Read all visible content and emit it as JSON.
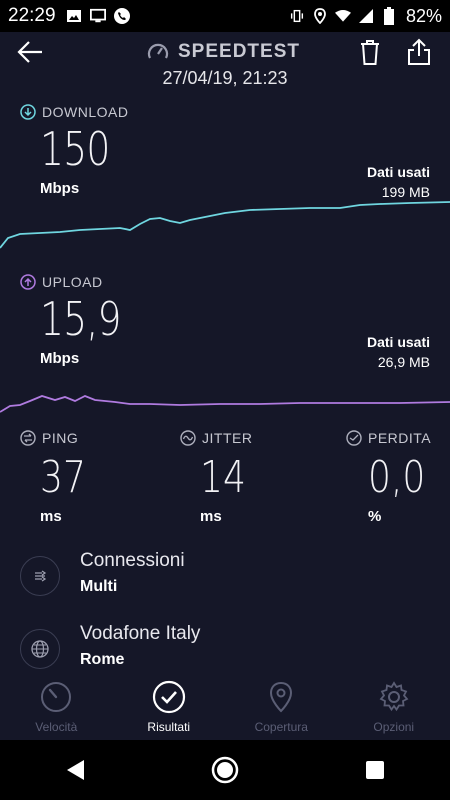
{
  "status_bar": {
    "time": "22:29",
    "battery": "82%"
  },
  "header": {
    "title": "SPEEDTEST",
    "datetime": "27/04/19, 21:23"
  },
  "download": {
    "label": "DOWNLOAD",
    "value": "150",
    "unit": "Mbps",
    "data_used_label": "Dati usati",
    "data_used_value": "199 MB",
    "color": "#6fd6e0"
  },
  "upload": {
    "label": "UPLOAD",
    "value": "15,9",
    "unit": "Mbps",
    "data_used_label": "Dati usati",
    "data_used_value": "26,9 MB",
    "color": "#b07be0"
  },
  "metrics": [
    {
      "label": "PING",
      "value": "37",
      "unit": "ms",
      "icon": "ping-icon"
    },
    {
      "label": "JITTER",
      "value": "14",
      "unit": "ms",
      "icon": "jitter-icon"
    },
    {
      "label": "PERDITA",
      "value": "0,0",
      "unit": "%",
      "icon": "loss-icon"
    }
  ],
  "info": [
    {
      "title": "Connessioni",
      "subtitle": "Multi",
      "icon": "connections-icon"
    },
    {
      "title": "Vodafone Italy",
      "subtitle": "Rome",
      "icon": "globe-icon"
    }
  ],
  "bottom_nav": [
    {
      "label": "Velocità",
      "icon": "speedometer-icon",
      "active": false
    },
    {
      "label": "Risultati",
      "icon": "check-circle-icon",
      "active": true
    },
    {
      "label": "Copertura",
      "icon": "map-pin-icon",
      "active": false
    },
    {
      "label": "Opzioni",
      "icon": "gear-icon",
      "active": false
    }
  ]
}
